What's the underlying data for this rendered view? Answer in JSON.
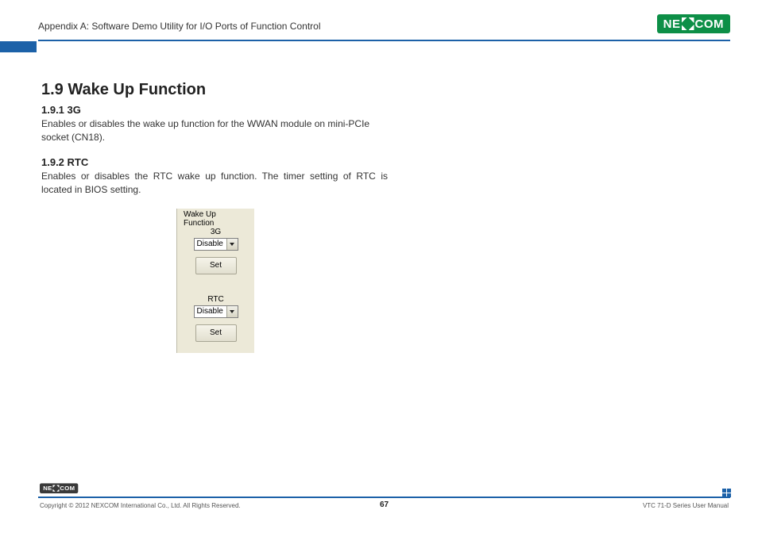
{
  "header": {
    "appendix": "Appendix A: Software Demo Utility for I/O Ports of Function Control",
    "brand_pre": "NE",
    "brand_post": "COM"
  },
  "section": {
    "title": "1.9  Wake Up Function",
    "s1_title": "1.9.1  3G",
    "s1_body": "Enables or disables the wake up function for the WWAN module on mini-PCIe socket (CN18).",
    "s2_title": "1.9.2  RTC",
    "s2_body": "Enables or disables the RTC wake up function. The timer setting of RTC is located in BIOS setting."
  },
  "panel": {
    "group_label": "Wake Up Function",
    "g3_label": "3G",
    "g3_value": "Disable",
    "g3_btn": "Set",
    "rtc_label": "RTC",
    "rtc_value": "Disable",
    "rtc_btn": "Set"
  },
  "footer": {
    "copyright": "Copyright © 2012 NEXCOM International Co., Ltd. All Rights Reserved.",
    "page": "67",
    "manual": "VTC 71-D Series User Manual"
  }
}
